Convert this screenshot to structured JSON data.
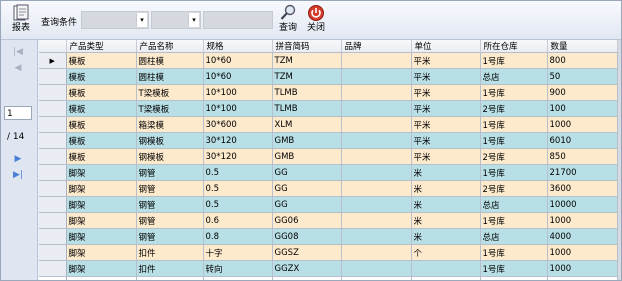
{
  "toolbar": {
    "report_label": "报表",
    "query_condition_label": "查询条件",
    "query_label": "查询",
    "close_label": "关闭"
  },
  "navigator": {
    "current_page": "1",
    "total_pages": "/ 14"
  },
  "columns": [
    "产品类型",
    "产品名称",
    "规格",
    "拼音简码",
    "品牌",
    "单位",
    "所在仓库",
    "数量"
  ],
  "rows": [
    [
      "模板",
      "圆柱模",
      "10*60",
      "TZM",
      "",
      "平米",
      "1号库",
      "800"
    ],
    [
      "模板",
      "圆柱模",
      "10*60",
      "TZM",
      "",
      "平米",
      "总店",
      "50"
    ],
    [
      "模板",
      "T梁模板",
      "10*100",
      "TLMB",
      "",
      "平米",
      "1号库",
      "900"
    ],
    [
      "模板",
      "T梁模板",
      "10*100",
      "TLMB",
      "",
      "平米",
      "2号库",
      "100"
    ],
    [
      "模板",
      "箱梁模",
      "30*600",
      "XLM",
      "",
      "平米",
      "1号库",
      "1000"
    ],
    [
      "模板",
      "钢模板",
      "30*120",
      "GMB",
      "",
      "平米",
      "1号库",
      "6010"
    ],
    [
      "模板",
      "钢模板",
      "30*120",
      "GMB",
      "",
      "平米",
      "2号库",
      "850"
    ],
    [
      "脚架",
      "钢管",
      "0.5",
      "GG",
      "",
      "米",
      "1号库",
      "21700"
    ],
    [
      "脚架",
      "钢管",
      "0.5",
      "GG",
      "",
      "米",
      "2号库",
      "3600"
    ],
    [
      "脚架",
      "钢管",
      "0.5",
      "GG",
      "",
      "米",
      "总店",
      "10000"
    ],
    [
      "脚架",
      "钢管",
      "0.6",
      "GG06",
      "",
      "米",
      "1号库",
      "1000"
    ],
    [
      "脚架",
      "钢管",
      "0.8",
      "GG08",
      "",
      "米",
      "总店",
      "4000"
    ],
    [
      "脚架",
      "扣件",
      "十字",
      "GGSZ",
      "",
      "个",
      "1号库",
      "1000"
    ],
    [
      "脚架",
      "扣件",
      "转向",
      "GGZX",
      "",
      "",
      "1号库",
      "1000"
    ]
  ],
  "colors": {
    "row_alt": "#fde9cc",
    "row_base": "#b8dfe6",
    "nav_accent": "#4a7fd8"
  }
}
